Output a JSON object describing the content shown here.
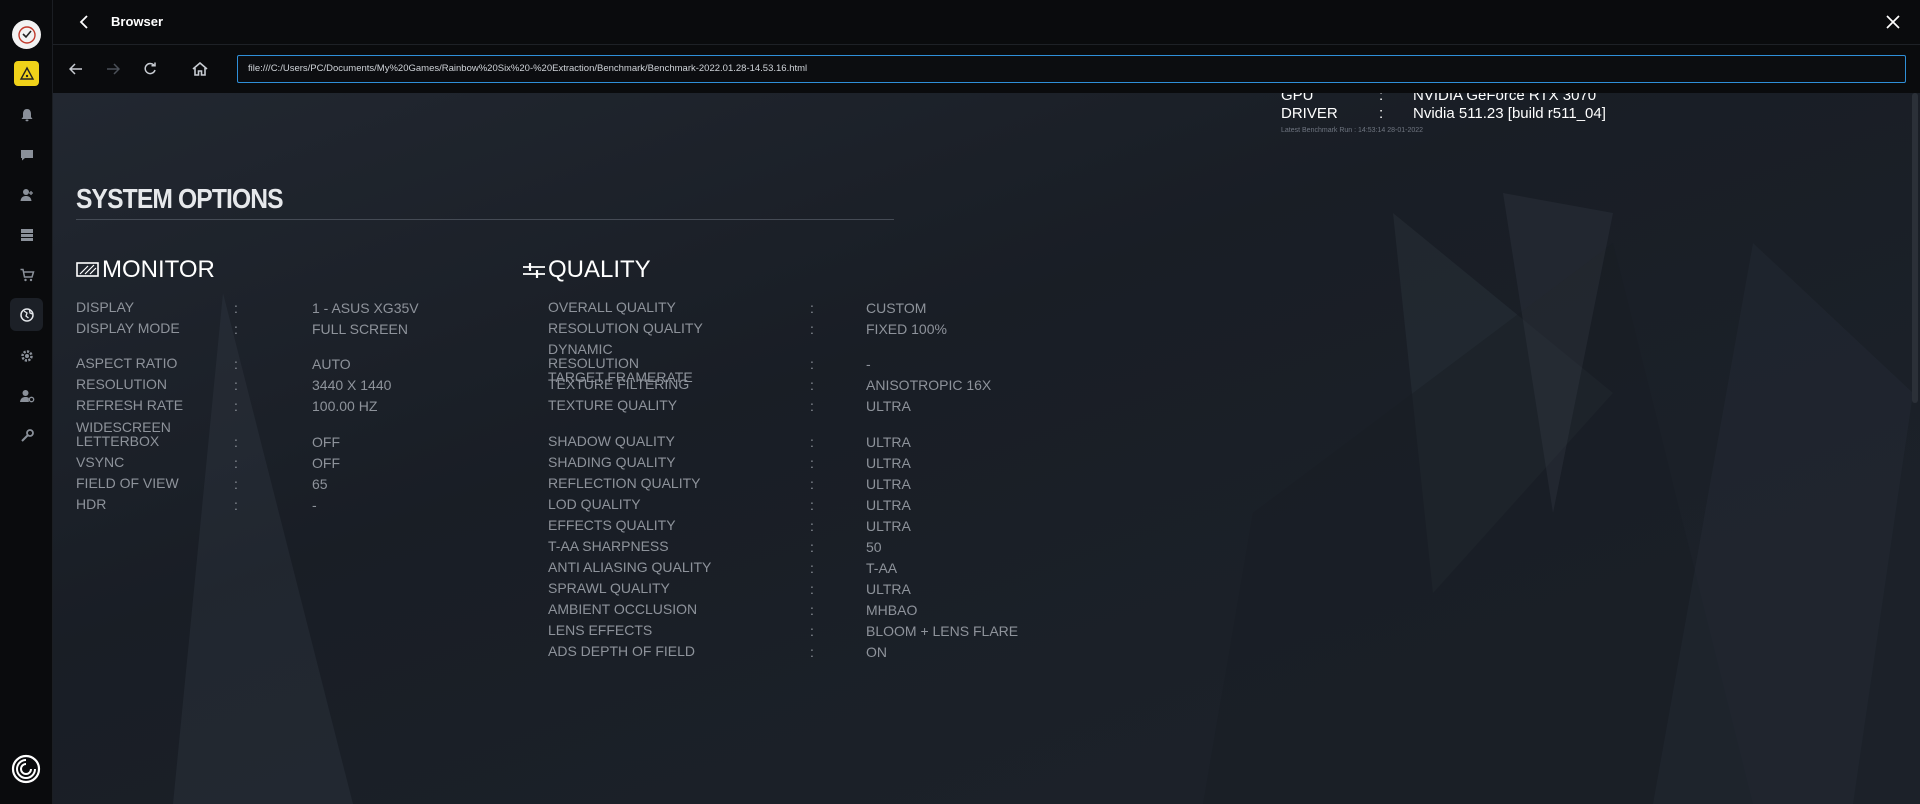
{
  "header": {
    "title": "Browser"
  },
  "navbar": {
    "url": "file:///C:/Users/PC/Documents/My%20Games/Rainbow%20Six%20-%20Extraction/Benchmark/Benchmark-2022.01.28-14.53.16.html"
  },
  "sidebar": {
    "items": [
      {
        "icon": "notifications-icon"
      },
      {
        "icon": "chat-icon"
      },
      {
        "icon": "friends-icon"
      },
      {
        "icon": "games-library-icon"
      },
      {
        "icon": "store-icon"
      },
      {
        "icon": "browser-icon",
        "active": true
      },
      {
        "icon": "settings-icon"
      },
      {
        "icon": "account-icon"
      },
      {
        "icon": "tools-icon"
      }
    ]
  },
  "gpu_info": {
    "gpu_label": "GPU",
    "gpu_value": "NVIDIA GeForce RTX 3070",
    "driver_label": "DRIVER",
    "driver_value": "Nvidia 511.23 [build r511_04]",
    "latest_run": "Latest Benchmark Run : 14:53:14 28-01-2022"
  },
  "system_options": {
    "title": "SYSTEM OPTIONS",
    "separator": ":",
    "monitor": {
      "title": "MONITOR",
      "rows": [
        {
          "label": "DISPLAY",
          "value": "1 - ASUS XG35V"
        },
        {
          "label": "DISPLAY MODE",
          "value": "FULL SCREEN"
        },
        {
          "label": "ASPECT RATIO",
          "value": "AUTO"
        },
        {
          "label": "RESOLUTION",
          "value": "3440 X 1440"
        },
        {
          "label": "REFRESH RATE",
          "value": "100.00 HZ"
        },
        {
          "label": "WIDESCREEN LETTERBOX",
          "value": "OFF"
        },
        {
          "label": "VSYNC",
          "value": "OFF"
        },
        {
          "label": "FIELD OF VIEW",
          "value": "65"
        },
        {
          "label": "HDR",
          "value": "-"
        }
      ]
    },
    "quality": {
      "title": "QUALITY",
      "rows": [
        {
          "label": "OVERALL QUALITY",
          "value": "CUSTOM"
        },
        {
          "label": "RESOLUTION QUALITY",
          "value": "FIXED 100%"
        },
        {
          "label": "DYNAMIC RESOLUTION TARGET FRAMERATE",
          "value": "-"
        },
        {
          "label": "TEXTURE FILTERING",
          "value": "ANISOTROPIC 16X"
        },
        {
          "label": "TEXTURE QUALITY",
          "value": "ULTRA"
        },
        {
          "label": "SHADOW QUALITY",
          "value": "ULTRA"
        },
        {
          "label": "SHADING QUALITY",
          "value": "ULTRA"
        },
        {
          "label": "REFLECTION QUALITY",
          "value": "ULTRA"
        },
        {
          "label": "LOD QUALITY",
          "value": "ULTRA"
        },
        {
          "label": "EFFECTS QUALITY",
          "value": "ULTRA"
        },
        {
          "label": "T-AA SHARPNESS",
          "value": "50"
        },
        {
          "label": "ANTI ALIASING QUALITY",
          "value": "T-AA"
        },
        {
          "label": "SPRAWL QUALITY",
          "value": "ULTRA"
        },
        {
          "label": "AMBIENT OCCLUSION",
          "value": "MHBAO"
        },
        {
          "label": "LENS EFFECTS",
          "value": "BLOOM + LENS FLARE"
        },
        {
          "label": "ADS DEPTH OF FIELD",
          "value": "ON"
        }
      ]
    }
  }
}
